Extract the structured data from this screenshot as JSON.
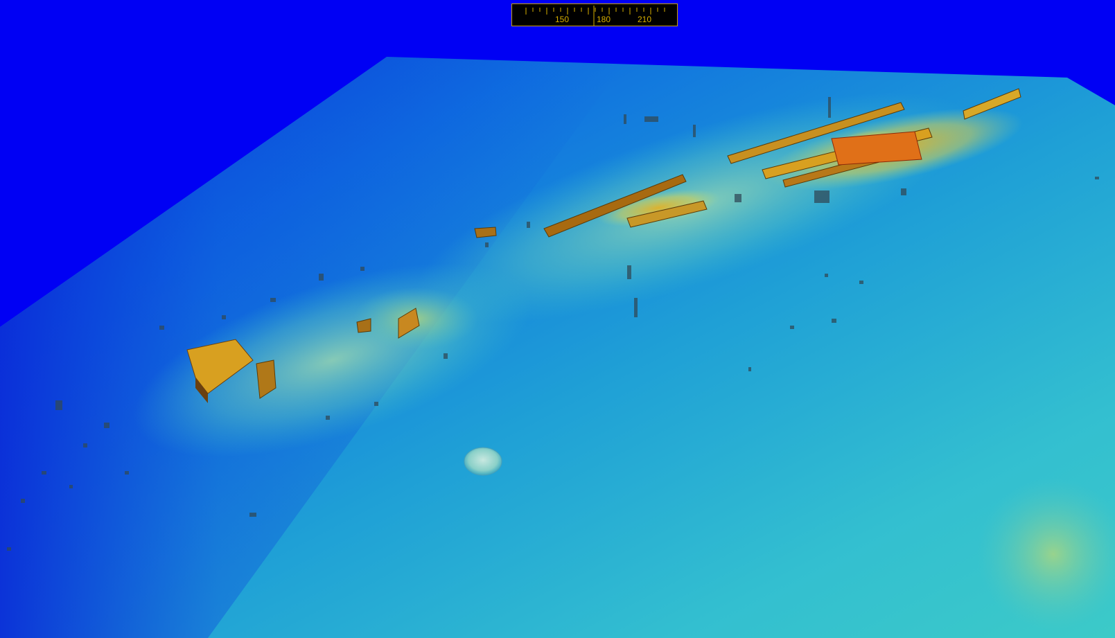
{
  "view": {
    "type": "3d-bathymetry-surface",
    "background_color": "#0000f4",
    "colormap": [
      "#0a2ad8",
      "#0a60e0",
      "#1aa0d8",
      "#3cc8cc",
      "#8ad8b0",
      "#d8d850",
      "#e0a020",
      "#c83010"
    ]
  },
  "compass": {
    "labels": [
      "150",
      "180",
      "210"
    ],
    "heading": "180",
    "tick_color": "#d8b000",
    "background": "#000000",
    "border_color": "#c8a000"
  }
}
